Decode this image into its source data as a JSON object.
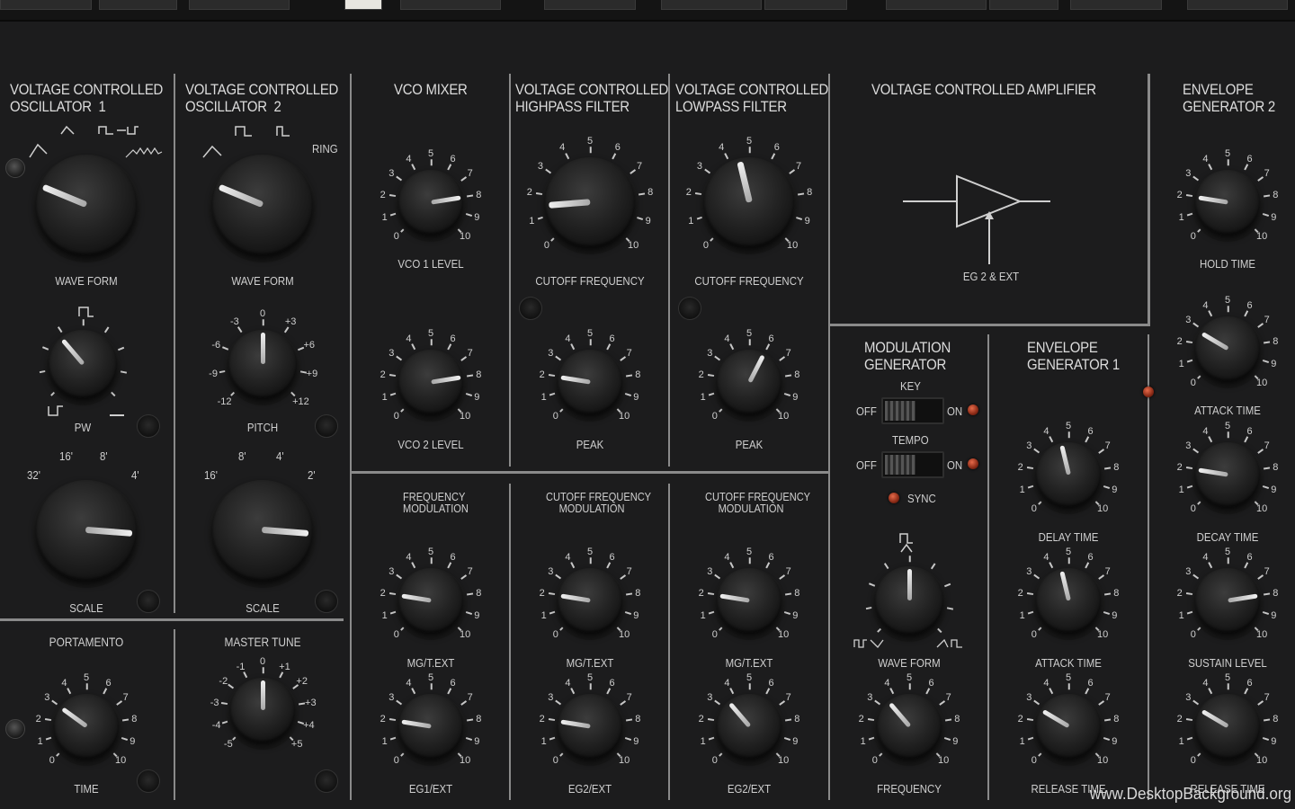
{
  "sections": {
    "vco1": "VOLTAGE CONTROLLED\nOSCILLATOR  1",
    "vco2": "VOLTAGE CONTROLLED\nOSCILLATOR  2",
    "mixer": "VCO MIXER",
    "hpf": "VOLTAGE CONTROLLED\nHIGHPASS FILTER",
    "lpf": "VOLTAGE CONTROLLED\nLOWPASS FILTER",
    "vca": "VOLTAGE CONTROLLED AMPLIFIER",
    "eg2": "ENVELOPE\nGENERATOR 2",
    "modgen": "MODULATION\nGENERATOR",
    "eg1": "ENVELOPE\nGENERATOR 1",
    "fm": "FREQUENCY\nMODULATION",
    "cfm1": "CUTOFF FREQUENCY\nMODULATION",
    "cfm2": "CUTOFF FREQUENCY\nMODULATION",
    "portamento": "PORTAMENTO",
    "master_tune": "MASTER TUNE"
  },
  "vca_label": "EG 2 & EXT",
  "vco1_marks": {
    "scale": [
      "32'",
      "16'",
      "8'",
      "4'"
    ]
  },
  "vco2_marks": {
    "ring": "RING",
    "scale": [
      "16'",
      "8'",
      "4'",
      "2'"
    ],
    "pitch": [
      "-12",
      "-9",
      "-6",
      "-3",
      "0",
      "+3",
      "+6",
      "+9",
      "+12"
    ]
  },
  "master_marks": [
    "-5",
    "-4",
    "-3",
    "-2",
    "-1",
    "0",
    "+1",
    "+2",
    "+3",
    "+4",
    "+5"
  ],
  "dial_numbers": [
    "0",
    "1",
    "2",
    "3",
    "4",
    "5",
    "6",
    "7",
    "8",
    "9",
    "10"
  ],
  "knobs": {
    "vco1_waveform": {
      "label": "WAVE FORM",
      "value": 0.25
    },
    "vco1_pw": {
      "label": "PW",
      "value": 0.35
    },
    "vco1_scale": {
      "label": "SCALE",
      "value": 0.85
    },
    "vco2_waveform": {
      "label": "WAVE FORM",
      "value": 0.25
    },
    "vco2_pitch": {
      "label": "PITCH",
      "value": 0.5
    },
    "vco2_scale": {
      "label": "SCALE",
      "value": 0.85
    },
    "vco1_level": {
      "label": "VCO 1 LEVEL",
      "value": 0.8
    },
    "vco2_level": {
      "label": "VCO 2 LEVEL",
      "value": 0.8
    },
    "hpf_cutoff": {
      "label": "CUTOFF FREQUENCY",
      "value": 0.15
    },
    "hpf_peak": {
      "label": "PEAK",
      "value": 0.2
    },
    "lpf_cutoff": {
      "label": "CUTOFF FREQUENCY",
      "value": 0.45
    },
    "lpf_peak": {
      "label": "PEAK",
      "value": 0.6
    },
    "fm_mg": {
      "label": "MG/T.EXT",
      "value": 0.2
    },
    "fm_eg1": {
      "label": "EG1/EXT",
      "value": 0.2
    },
    "cfm1_mg": {
      "label": "MG/T.EXT",
      "value": 0.2
    },
    "cfm1_eg2": {
      "label": "EG2/EXT",
      "value": 0.2
    },
    "cfm2_mg": {
      "label": "MG/T.EXT",
      "value": 0.2
    },
    "cfm2_eg2": {
      "label": "EG2/EXT",
      "value": 0.35
    },
    "mg_waveform": {
      "label": "WAVE FORM",
      "value": 0.5
    },
    "mg_frequency": {
      "label": "FREQUENCY",
      "value": 0.35
    },
    "eg1_delay": {
      "label": "DELAY TIME",
      "value": 0.45
    },
    "eg1_attack": {
      "label": "ATTACK TIME",
      "value": 0.45
    },
    "eg1_release": {
      "label": "RELEASE TIME",
      "value": 0.28
    },
    "eg2_hold": {
      "label": "HOLD TIME",
      "value": 0.2
    },
    "eg2_attack": {
      "label": "ATTACK TIME",
      "value": 0.28
    },
    "eg2_decay": {
      "label": "DECAY TIME",
      "value": 0.2
    },
    "eg2_sustain": {
      "label": "SUSTAIN LEVEL",
      "value": 0.8
    },
    "eg2_release": {
      "label": "RELEASE TIME",
      "value": 0.28
    },
    "portamento_time": {
      "label": "TIME",
      "value": 0.3
    },
    "master_tune": {
      "label": "",
      "value": 0.5
    }
  },
  "switches": {
    "key": {
      "label": "KEY",
      "off": "OFF",
      "on": "ON"
    },
    "tempo": {
      "label": "TEMPO",
      "off": "OFF",
      "on": "ON"
    },
    "sync": "SYNC"
  },
  "watermark": "www.DesktopBackground.org"
}
